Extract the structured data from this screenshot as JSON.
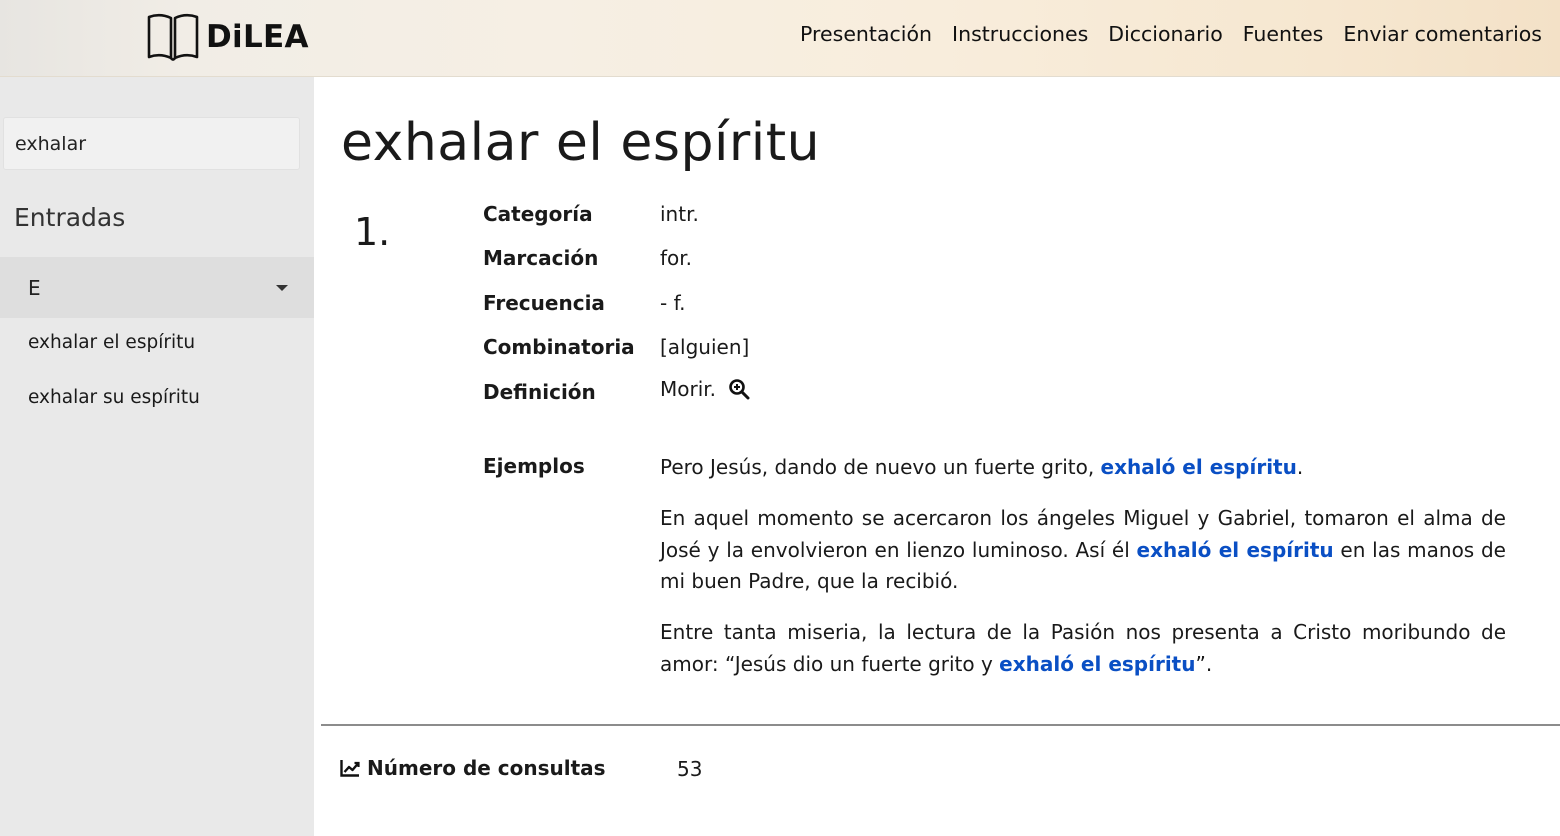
{
  "header": {
    "logo_text": "DiLEA",
    "nav": [
      "Presentación",
      "Instrucciones",
      "Diccionario",
      "Fuentes",
      "Enviar comentarios"
    ]
  },
  "sidebar": {
    "search_value": "exhalar",
    "title": "Entradas",
    "group_letter": "E",
    "entries": [
      "exhalar el espíritu",
      "exhalar su espíritu"
    ]
  },
  "entry": {
    "title": "exhalar el espíritu",
    "sense_number": "1.",
    "labels": {
      "categoria": "Categoría",
      "marcacion": "Marcación",
      "frecuencia": "Frecuencia",
      "combinatoria": "Combinatoria",
      "definicion": "Definición",
      "ejemplos": "Ejemplos"
    },
    "values": {
      "categoria": "intr.",
      "marcacion": "for.",
      "frecuencia": "- f.",
      "combinatoria": "[alguien]",
      "definicion": "Morir."
    },
    "examples": [
      {
        "before": "Pero Jesús, dando de nuevo un fuerte grito, ",
        "highlight": "exhaló el espíritu",
        "after": "."
      },
      {
        "before": "En aquel momento se acercaron los ángeles Miguel y Gabriel, tomaron el alma de José y la envolvieron en lienzo luminoso. Así él ",
        "highlight": "exhaló el espíritu",
        "after": " en las manos de mi buen Padre, que la recibió."
      },
      {
        "before": "Entre tanta miseria, la lectura de la Pasión nos presenta a Cristo moribundo de amor: “Jesús dio un fuerte grito y ",
        "highlight": "exhaló el espíritu",
        "after": "”."
      }
    ]
  },
  "stats": {
    "label": "Número de consultas",
    "value": "53"
  },
  "colors": {
    "highlight": "#0a4fc4",
    "sidebar_bg": "#e9e9e9",
    "group_bg": "#dedede"
  }
}
